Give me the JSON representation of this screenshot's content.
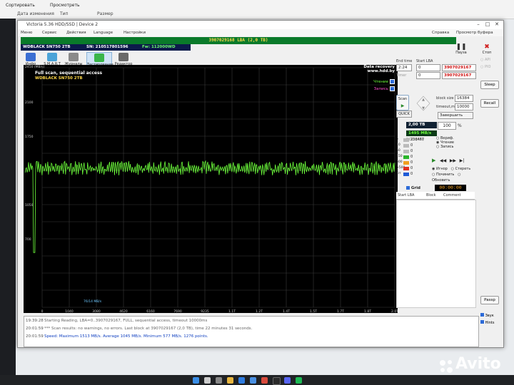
{
  "explorer": {
    "sort_label": "Сортировать",
    "view_label": "Просмотреть",
    "col_date": "Дата изменения",
    "col_type": "Тип",
    "col_size": "Размер",
    "row_date": "23.10.2022 19:07"
  },
  "window": {
    "title": "Victoria 5.36 HDD/SSD | Device 2",
    "menu": [
      "Меню",
      "Сервис",
      "Действия",
      "Language",
      "Настройки"
    ],
    "help_label": "Справка",
    "clipboard_label": "Просмотр буфера"
  },
  "device": {
    "lba_banner": "3907029168 LBA (2,0 TB)",
    "model": "WDBLACK SN750 2TB",
    "serial": "SN: 210517801596",
    "firmware": "Fw: 112000WD"
  },
  "toolbar": {
    "items": [
      "Инфо",
      "S.M.A.R.T",
      "Журналы",
      "Тестирование",
      "Редактор"
    ],
    "pause_label": "Пауза",
    "stop_label": "Стоп"
  },
  "graph": {
    "title": "Full scan, sequential access",
    "subtitle": "WDBLACK SN750 2TB",
    "data_recovery": "Data recovery",
    "site": "www.hdd.by",
    "legend_read": "Чтение",
    "legend_write": "Запись",
    "y_unit": "2450 (MB/s)",
    "annotation": "76/14 MB/s"
  },
  "chart_data": {
    "type": "line",
    "title": "Full scan, sequential access",
    "subtitle": "WDBLACK SN750 2TB",
    "ylabel": "MB/s",
    "ylim": [
      0,
      2450
    ],
    "y_ticks": [
      2100,
      1750,
      1050,
      700
    ],
    "x_ticks": [
      "0",
      "1040",
      "3080",
      "4620",
      "6160",
      "7690",
      "9235",
      "1.1T",
      "1.2T",
      "1.4T",
      "1.5T",
      "1.7T",
      "1.8T",
      "2.0T"
    ],
    "series": [
      {
        "name": "Чтение",
        "color": "#6dff3b",
        "baseline": 1450,
        "min": 560,
        "max": 1513,
        "avg": 1045
      }
    ],
    "grid": true
  },
  "panel": {
    "end_lba_label": "End time",
    "start_lba_label": "Start LBA",
    "end_lba_value": "3907029167",
    "timer_label": "Timer",
    "lba_value_2": "3907029167",
    "zero": "0",
    "max_label": "MAX",
    "time_value": "2:24",
    "block_size_label": "block size",
    "block_size": "16384",
    "timeout_label": "timeout,ms",
    "timeout": "10000",
    "scan_label": "Scan",
    "quick_label": "QUICK",
    "end_action": "Завершить",
    "size": "2,00 TB",
    "percent": "100",
    "percent_sign": "%",
    "speed": "1495 MB/s",
    "ddd_label": "DDD (API)",
    "verify_label": "Вериф.",
    "read_label": "Чтение",
    "write_label": "Запись",
    "ignore_label": "Игнор",
    "erase_label": "Стереть",
    "fix_label": "Починить",
    "update_label": "Обновить",
    "grid_label": "Grid",
    "timer": "00:00:00",
    "tab_start": "Start LBA",
    "tab_block": "Block",
    "tab_comment": "Comment",
    "counts": [
      {
        "label": "5",
        "value": "238467",
        "color": "#bbbbbb"
      },
      {
        "label": "10",
        "value": "0",
        "color": "#bbbbbb"
      },
      {
        "label": "50",
        "value": "0",
        "color": "#bbbbbb"
      },
      {
        "label": "150",
        "value": "0",
        "color": "#2bb52b"
      },
      {
        "label": "500",
        "value": "0",
        "color": "#f0a020"
      },
      {
        "label": ">500",
        "value": "0",
        "color": "#e03020"
      },
      {
        "label": "Err",
        "value": "0",
        "color": "#1e5ad6"
      }
    ]
  },
  "right_col": {
    "api": "API",
    "pio": "PIO",
    "sleep": "Sleep",
    "recall": "Recall",
    "passp": "Passp",
    "sound": "Звук",
    "hints": "Hints"
  },
  "log": [
    {
      "time": "19:39:28",
      "text": "Starting Reading, LBA=0..3907029167, FULL, sequential access, timeout 10000ms",
      "kind": "m1"
    },
    {
      "time": "20:01:59",
      "text": "*** Scan results: no warnings, no errors. Last block at 3907029167 (2,0 TB), time 22 minutes 31 seconds.",
      "kind": "m1"
    },
    {
      "time": "20:01:59",
      "text": "Speed: Maximum 1513 MB/s. Average 1045 MB/s. Minimum 577 MB/s. 1276 points.",
      "kind": "m2"
    }
  ],
  "watermark": "Avito"
}
